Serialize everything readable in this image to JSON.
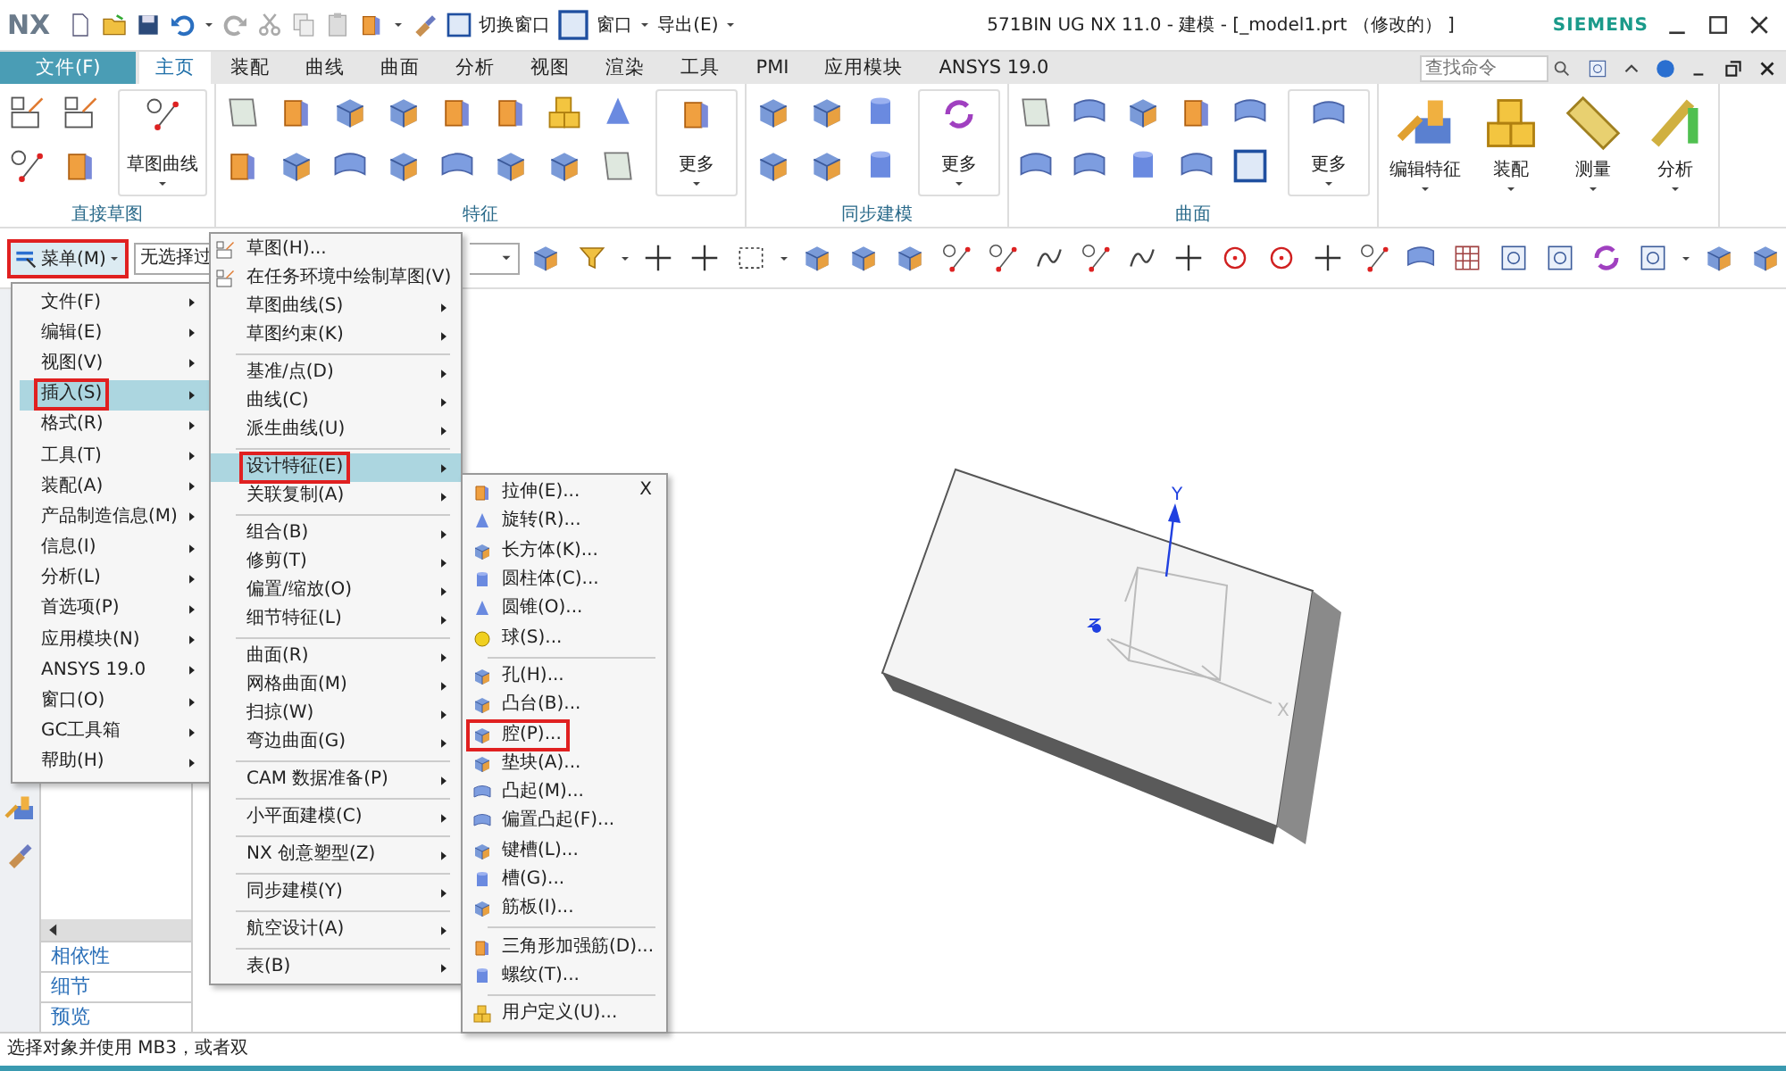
{
  "title_bar": {
    "logo": "NX",
    "switch_window": "切换窗口",
    "window_menu": "窗口",
    "export_menu": "导出(E)",
    "title": "571BIN UG NX 11.0 - 建模 - [_model1.prt （修改的） ]",
    "brand": "SIEMENS"
  },
  "tabs": [
    {
      "label": "文件(F)",
      "kind": "file",
      "selected": false
    },
    {
      "label": "主页",
      "kind": "tab",
      "selected": true
    },
    {
      "label": "装配",
      "kind": "tab",
      "selected": false
    },
    {
      "label": "曲线",
      "kind": "tab",
      "selected": false
    },
    {
      "label": "曲面",
      "kind": "tab",
      "selected": false
    },
    {
      "label": "分析",
      "kind": "tab",
      "selected": false
    },
    {
      "label": "视图",
      "kind": "tab",
      "selected": false
    },
    {
      "label": "渲染",
      "kind": "tab",
      "selected": false
    },
    {
      "label": "工具",
      "kind": "tab",
      "selected": false
    },
    {
      "label": "PMI",
      "kind": "tab",
      "selected": false
    },
    {
      "label": "应用模块",
      "kind": "tab",
      "selected": false
    },
    {
      "label": "ANSYS 19.0",
      "kind": "tab",
      "selected": false
    }
  ],
  "search": {
    "placeholder": "查找命令"
  },
  "ribbon": {
    "groups": [
      {
        "label": "直接草图",
        "buttons": [
          "草图曲线"
        ]
      },
      {
        "label": "特征",
        "buttons": [
          "更多"
        ]
      },
      {
        "label": "同步建模",
        "buttons": [
          "更多"
        ]
      },
      {
        "label": "曲面",
        "buttons": [
          "更多"
        ]
      },
      {
        "buttons": [
          "编辑特征",
          "装配",
          "测量",
          "分析"
        ]
      }
    ]
  },
  "toolbar": {
    "menu_button": {
      "label": "菜单(M)",
      "marked": true
    },
    "filter_value": "无选择过"
  },
  "main_menu": {
    "items": [
      {
        "label": "文件(F)",
        "selected": false,
        "marked": false
      },
      {
        "label": "编辑(E)",
        "selected": false,
        "marked": false
      },
      {
        "label": "视图(V)",
        "selected": false,
        "marked": false
      },
      {
        "label": "插入(S)",
        "selected": true,
        "marked": true
      },
      {
        "label": "格式(R)",
        "selected": false,
        "marked": false
      },
      {
        "label": "工具(T)",
        "selected": false,
        "marked": false
      },
      {
        "label": "装配(A)",
        "selected": false,
        "marked": false
      },
      {
        "label": "产品制造信息(M)",
        "selected": false,
        "marked": false
      },
      {
        "label": "信息(I)",
        "selected": false,
        "marked": false
      },
      {
        "label": "分析(L)",
        "selected": false,
        "marked": false
      },
      {
        "label": "首选项(P)",
        "selected": false,
        "marked": false
      },
      {
        "label": "应用模块(N)",
        "selected": false,
        "marked": false
      },
      {
        "label": "ANSYS 19.0",
        "selected": false,
        "marked": false
      },
      {
        "label": "窗口(O)",
        "selected": false,
        "marked": false
      },
      {
        "label": "GC工具箱",
        "selected": false,
        "marked": false
      },
      {
        "label": "帮助(H)",
        "selected": false,
        "marked": false
      }
    ]
  },
  "insert_menu": {
    "sections": [
      [
        {
          "label": "草图(H)...",
          "kind": "command",
          "selected": false,
          "marked": false
        },
        {
          "label": "在任务环境中绘制草图(V)",
          "kind": "command",
          "selected": false,
          "marked": false
        },
        {
          "label": "草图曲线(S)",
          "kind": "submenu",
          "selected": false,
          "marked": false
        },
        {
          "label": "草图约束(K)",
          "kind": "submenu",
          "selected": false,
          "marked": false
        }
      ],
      [
        {
          "label": "基准/点(D)",
          "kind": "submenu",
          "selected": false,
          "marked": false
        },
        {
          "label": "曲线(C)",
          "kind": "submenu",
          "selected": false,
          "marked": false
        },
        {
          "label": "派生曲线(U)",
          "kind": "submenu",
          "selected": false,
          "marked": false
        }
      ],
      [
        {
          "label": "设计特征(E)",
          "kind": "submenu",
          "selected": true,
          "marked": true
        },
        {
          "label": "关联复制(A)",
          "kind": "submenu",
          "selected": false,
          "marked": false
        }
      ],
      [
        {
          "label": "组合(B)",
          "kind": "submenu",
          "selected": false,
          "marked": false
        },
        {
          "label": "修剪(T)",
          "kind": "submenu",
          "selected": false,
          "marked": false
        },
        {
          "label": "偏置/缩放(O)",
          "kind": "submenu",
          "selected": false,
          "marked": false
        },
        {
          "label": "细节特征(L)",
          "kind": "submenu",
          "selected": false,
          "marked": false
        }
      ],
      [
        {
          "label": "曲面(R)",
          "kind": "submenu",
          "selected": false,
          "marked": false
        },
        {
          "label": "网格曲面(M)",
          "kind": "submenu",
          "selected": false,
          "marked": false
        },
        {
          "label": "扫掠(W)",
          "kind": "submenu",
          "selected": false,
          "marked": false
        },
        {
          "label": "弯边曲面(G)",
          "kind": "submenu",
          "selected": false,
          "marked": false
        }
      ],
      [
        {
          "label": "CAM 数据准备(P)",
          "kind": "submenu",
          "selected": false,
          "marked": false
        }
      ],
      [
        {
          "label": "小平面建模(C)",
          "kind": "submenu",
          "selected": false,
          "marked": false
        }
      ],
      [
        {
          "label": "NX 创意塑型(Z)",
          "kind": "submenu",
          "selected": false,
          "marked": false
        }
      ],
      [
        {
          "label": "同步建模(Y)",
          "kind": "submenu",
          "selected": false,
          "marked": false
        }
      ],
      [
        {
          "label": "航空设计(A)",
          "kind": "submenu",
          "selected": false,
          "marked": false
        }
      ],
      [
        {
          "label": "表(B)",
          "kind": "submenu",
          "selected": false,
          "marked": false
        }
      ]
    ]
  },
  "design_menu": {
    "close_label": "X",
    "sections": [
      [
        {
          "label": "拉伸(E)...",
          "marked": false
        },
        {
          "label": "旋转(R)...",
          "marked": false
        },
        {
          "label": "长方体(K)...",
          "marked": false
        },
        {
          "label": "圆柱体(C)...",
          "marked": false
        },
        {
          "label": "圆锥(O)...",
          "marked": false
        },
        {
          "label": "球(S)...",
          "marked": false
        }
      ],
      [
        {
          "label": "孔(H)...",
          "marked": false
        },
        {
          "label": "凸台(B)...",
          "marked": false
        },
        {
          "label": "腔(P)...",
          "marked": true
        },
        {
          "label": "垫块(A)...",
          "marked": false
        },
        {
          "label": "凸起(M)...",
          "marked": false
        },
        {
          "label": "偏置凸起(F)...",
          "marked": false
        },
        {
          "label": "键槽(L)...",
          "marked": false
        },
        {
          "label": "槽(G)...",
          "marked": false
        },
        {
          "label": "筋板(I)...",
          "marked": false
        }
      ],
      [
        {
          "label": "三角形加强筋(D)...",
          "marked": false
        },
        {
          "label": "螺纹(T)...",
          "marked": false
        }
      ],
      [
        {
          "label": "用户定义(U)...",
          "marked": false
        }
      ]
    ]
  },
  "navigator": {
    "panels": [
      "相依性",
      "细节",
      "预览"
    ]
  },
  "viewport": {
    "y_axis_label": "Y",
    "x_axis_label": "X"
  },
  "status_bar": {
    "text": "选择对象并使用 MB3，或者双"
  }
}
